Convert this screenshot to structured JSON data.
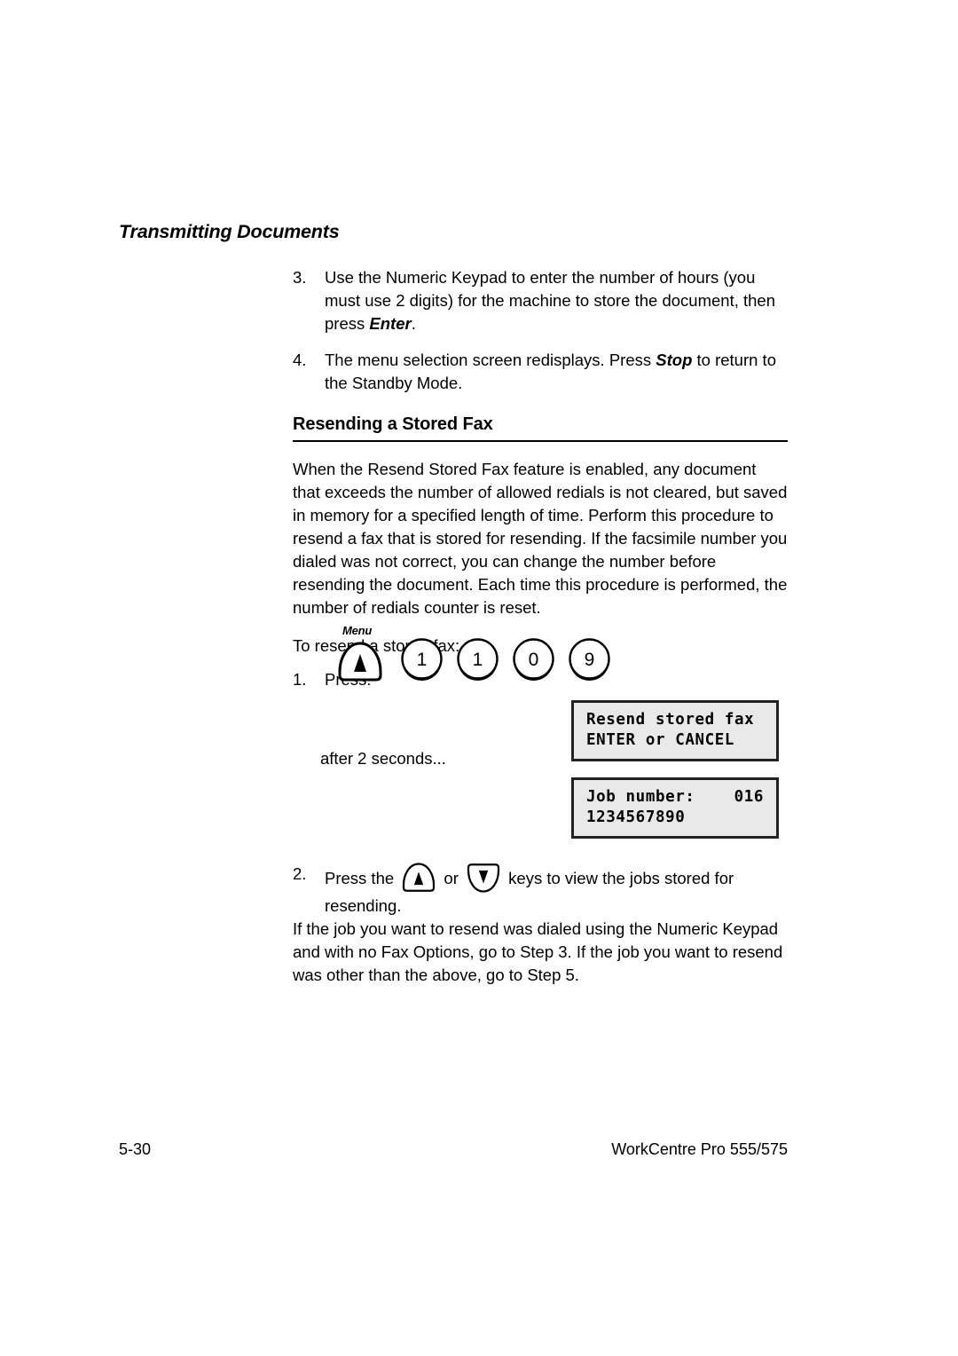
{
  "running_head": "Transmitting Documents",
  "steps_top": [
    {
      "num": "3.",
      "text_before": "Use the Numeric Keypad to enter the number of hours (you must use 2 digits) for the machine to store the document, then press ",
      "emphasis": "Enter",
      "text_after": "."
    },
    {
      "num": "4.",
      "text_before": "The menu selection screen redisplays. Press ",
      "emphasis": "Stop",
      "text_after": " to return to the Standby Mode."
    }
  ],
  "section": {
    "title": "Resending a Stored Fax",
    "body": "When the Resend Stored Fax feature is enabled, any document that exceeds the number of allowed redials is not cleared, but saved in memory for a specified length of time. Perform this procedure to resend a fax that is stored for resending. If the facsimile number you dialed was not correct, you can change the number before resending the document. Each time this procedure is performed, the number of redials counter is reset.",
    "lead_in": "To resend a stored fax:"
  },
  "step_one": {
    "num": "1.",
    "label": "Press:"
  },
  "key_sequence": {
    "menu_label": "Menu",
    "menu_icon": "menu-dome-up-arrow-key",
    "digits": [
      "1",
      "1",
      "0",
      "9"
    ]
  },
  "lcd_1": {
    "line1": "Resend stored fax",
    "line2": "ENTER or CANCEL"
  },
  "lcd_2": {
    "line1_left": "Job number:",
    "line1_right": "016",
    "line2": "1234567890"
  },
  "after_seconds": "after 2 seconds...",
  "step_two": {
    "num": "2.",
    "text_before": "Press the ",
    "up_icon": "up-arrow-dome-key",
    "conjunction": " or ",
    "down_icon": "down-arrow-dome-key",
    "text_after": " keys to view the jobs stored for resending."
  },
  "trailing_paragraph": "If the job you want to resend was dialed using the Numeric Keypad and with no Fax Options, go to Step 3. If the job you want to resend was other than the above, go to Step 5.",
  "footer": {
    "page_number": "5-30",
    "product": "WorkCentre Pro 555/575"
  },
  "colors": {
    "text": "#000000",
    "page_background": "#ffffff",
    "lcd_background": "#e9e9e9",
    "lcd_border": "#222222"
  }
}
